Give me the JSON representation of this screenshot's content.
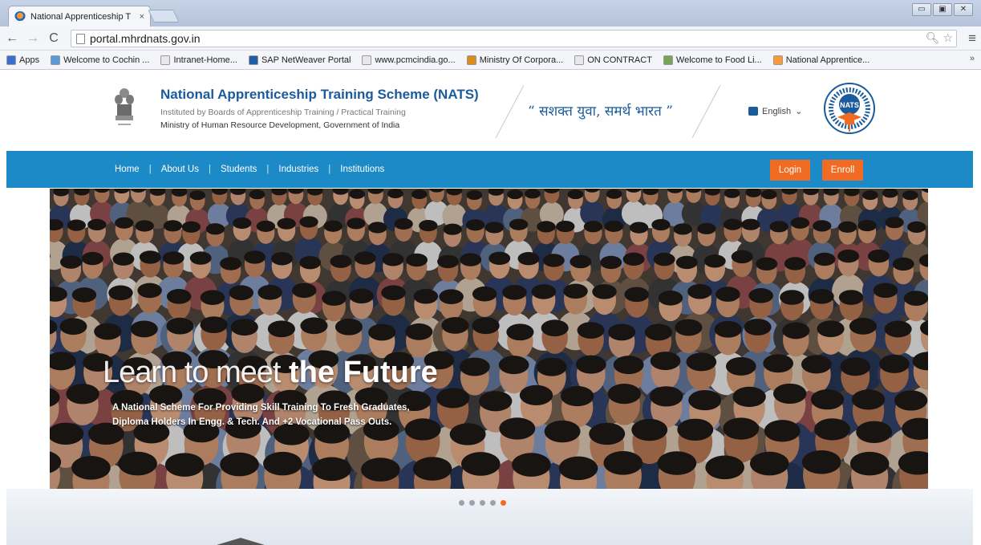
{
  "browser": {
    "tab_title": "National Apprenticeship T",
    "tab_close": "×",
    "url": "portal.mhrdnats.gov.in",
    "win_controls": [
      "▭",
      "▣",
      "✕"
    ],
    "bookmarks": [
      {
        "label": "Apps",
        "color": "#3b6fcf"
      },
      {
        "label": "Welcome to Cochin ...",
        "color": "#5a9bd6"
      },
      {
        "label": "Intranet-Home...",
        "color": "#e8e8e8"
      },
      {
        "label": "SAP NetWeaver Portal",
        "color": "#1f5da8"
      },
      {
        "label": "www.pcmcindia.go...",
        "color": "#e8e8e8"
      },
      {
        "label": "Ministry Of Corpora...",
        "color": "#d98c1a"
      },
      {
        "label": "ON CONTRACT",
        "color": "#e8e8e8"
      },
      {
        "label": "Welcome to Food Li...",
        "color": "#7aa35a"
      },
      {
        "label": "National Apprentice...",
        "color": "#f79a37"
      }
    ],
    "bookmarks_more": "»"
  },
  "header": {
    "title": "National Apprenticeship Training Scheme (NATS)",
    "subtitle1": "Instituted by Boards of Apprenticeship Training / Practical Training",
    "subtitle2": "Ministry of Human Resource Development, Government of India",
    "slogan": "“ सशक्त युवा, समर्थ भारत ”",
    "language": "English",
    "language_caret": "⌄",
    "logo_badge": "NATS"
  },
  "nav": {
    "items": [
      "Home",
      "About Us",
      "Students",
      "Industries",
      "Institutions"
    ],
    "separator": "|",
    "login_label": "Login",
    "enroll_label": "Enroll"
  },
  "hero": {
    "headline_light": "Learn to meet",
    "headline_bold": "the Future",
    "sub_line1": "A National Scheme For Providing Skill Training To Fresh Graduates,",
    "sub_line2": "Diploma Holders In Engg. & Tech. And +2 Vocational Pass Outs."
  },
  "carousel": {
    "count": 5,
    "active_index": 4
  },
  "colors": {
    "brand_blue": "#1c8ac6",
    "accent_orange": "#f26b22",
    "title_blue": "#1a5b9c"
  }
}
